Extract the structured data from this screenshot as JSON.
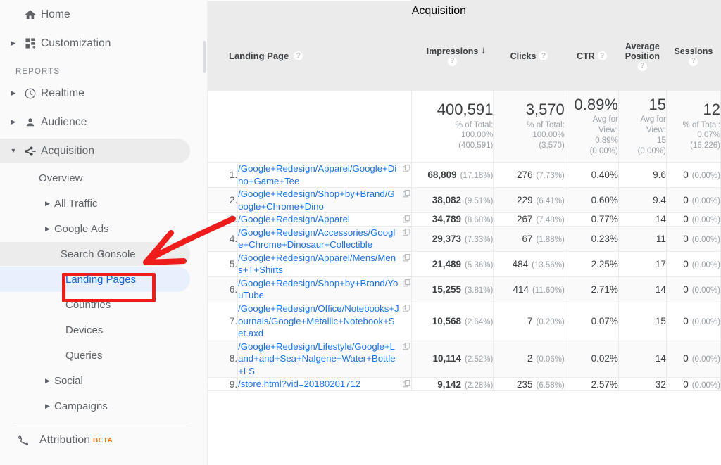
{
  "sidebar": {
    "top_items": [
      {
        "label": "Home",
        "icon": "home-icon",
        "has_arrow": false
      },
      {
        "label": "Customization",
        "icon": "customization-icon",
        "has_arrow": true
      }
    ],
    "section_label": "REPORTS",
    "report_items": [
      {
        "label": "Realtime",
        "icon": "clock-icon",
        "has_arrow": true,
        "state": "normal"
      },
      {
        "label": "Audience",
        "icon": "person-icon",
        "has_arrow": true,
        "state": "normal"
      },
      {
        "label": "Acquisition",
        "icon": "acquisition-icon",
        "has_arrow": true,
        "state": "expanded-highlight"
      }
    ],
    "acquisition_children": [
      {
        "label": "Overview",
        "has_caret": false,
        "state": "normal"
      },
      {
        "label": "All Traffic",
        "has_caret": true,
        "state": "normal"
      },
      {
        "label": "Google Ads",
        "has_caret": true,
        "state": "normal"
      },
      {
        "label": "Search Console",
        "has_caret": true,
        "state": "expanded-highlight"
      },
      {
        "label": "Landing Pages",
        "has_caret": false,
        "state": "selected",
        "annotated": true
      },
      {
        "label": "Countries",
        "has_caret": false,
        "state": "normal"
      },
      {
        "label": "Devices",
        "has_caret": false,
        "state": "normal"
      },
      {
        "label": "Queries",
        "has_caret": false,
        "state": "normal"
      },
      {
        "label": "Social",
        "has_caret": true,
        "state": "normal"
      },
      {
        "label": "Campaigns",
        "has_caret": true,
        "state": "normal"
      }
    ],
    "attribution": {
      "label": "Attribution",
      "badge": "BETA",
      "icon": "attribution-icon"
    },
    "colors": {
      "selected_bg": "#e8f0fe",
      "selected_text": "#1967d2",
      "highlight_bg": "#ececec",
      "text": "#5f6368",
      "beta_badge": "#e8710a"
    }
  },
  "table": {
    "group_header": "Acquisition",
    "dimension_header": {
      "label": "Landing Page",
      "help": "?"
    },
    "columns": [
      {
        "label": "Impressions",
        "help": "?",
        "sorted": true,
        "sort_dir": "desc",
        "sort_glyph": "↓"
      },
      {
        "label": "Clicks",
        "help": "?",
        "sorted": false
      },
      {
        "label": "CTR",
        "help": "?",
        "sorted": false
      },
      {
        "label": "Average Position",
        "help": "?",
        "sorted": false
      },
      {
        "label": "Sessions",
        "help": "?",
        "sorted": false
      }
    ],
    "summary": [
      {
        "big": "400,591",
        "lines": [
          "% of Total:",
          "100.00%",
          "(400,591)"
        ]
      },
      {
        "big": "3,570",
        "lines": [
          "% of Total:",
          "100.00%",
          "(3,570)"
        ]
      },
      {
        "big": "0.89%",
        "lines": [
          "Avg for",
          "View:",
          "0.89%",
          "(0.00%)"
        ]
      },
      {
        "big": "15",
        "lines": [
          "Avg for",
          "View:",
          "15",
          "(0.00%)"
        ]
      },
      {
        "big": "12",
        "lines": [
          "% of Total:",
          "0.07%",
          "(16,226)"
        ]
      }
    ],
    "rows": [
      {
        "index": "1.",
        "url": "/Google+Redesign/Apparel/Google+Dino+Game+Tee",
        "impressions": "68,809",
        "impressions_pct": "(17.18%)",
        "clicks": "276",
        "clicks_pct": "(7.73%)",
        "ctr": "0.40%",
        "avg_position": "9.6",
        "sessions": "0",
        "sessions_pct": "(0.00%)"
      },
      {
        "index": "2.",
        "url": "/Google+Redesign/Shop+by+Brand/Google+Chrome+Dino",
        "impressions": "38,082",
        "impressions_pct": "(9.51%)",
        "clicks": "229",
        "clicks_pct": "(6.41%)",
        "ctr": "0.60%",
        "avg_position": "9.4",
        "sessions": "0",
        "sessions_pct": "(0.00%)"
      },
      {
        "index": "3.",
        "url": "/Google+Redesign/Apparel",
        "impressions": "34,789",
        "impressions_pct": "(8.68%)",
        "clicks": "267",
        "clicks_pct": "(7.48%)",
        "ctr": "0.77%",
        "avg_position": "14",
        "sessions": "0",
        "sessions_pct": "(0.00%)"
      },
      {
        "index": "4.",
        "url": "/Google+Redesign/Accessories/Google+Chrome+Dinosaur+Collectible",
        "impressions": "29,373",
        "impressions_pct": "(7.33%)",
        "clicks": "67",
        "clicks_pct": "(1.88%)",
        "ctr": "0.23%",
        "avg_position": "11",
        "sessions": "0",
        "sessions_pct": "(0.00%)"
      },
      {
        "index": "5.",
        "url": "/Google+Redesign/Apparel/Mens/Mens+T+Shirts",
        "impressions": "21,489",
        "impressions_pct": "(5.36%)",
        "clicks": "484",
        "clicks_pct": "(13.56%)",
        "ctr": "2.25%",
        "avg_position": "17",
        "sessions": "0",
        "sessions_pct": "(0.00%)"
      },
      {
        "index": "6.",
        "url": "/Google+Redesign/Shop+by+Brand/YouTube",
        "impressions": "15,255",
        "impressions_pct": "(3.81%)",
        "clicks": "414",
        "clicks_pct": "(11.60%)",
        "ctr": "2.71%",
        "avg_position": "14",
        "sessions": "0",
        "sessions_pct": "(0.00%)"
      },
      {
        "index": "7.",
        "url": "/Google+Redesign/Office/Notebooks+Journals/Google+Metallic+Notebook+Set.axd",
        "impressions": "10,568",
        "impressions_pct": "(2.64%)",
        "clicks": "7",
        "clicks_pct": "(0.20%)",
        "ctr": "0.07%",
        "avg_position": "15",
        "sessions": "0",
        "sessions_pct": "(0.00%)"
      },
      {
        "index": "8.",
        "url": "/Google+Redesign/Lifestyle/Google+Land+and+Sea+Nalgene+Water+Bottle+LS",
        "impressions": "10,114",
        "impressions_pct": "(2.52%)",
        "clicks": "2",
        "clicks_pct": "(0.06%)",
        "ctr": "0.02%",
        "avg_position": "14",
        "sessions": "0",
        "sessions_pct": "(0.00%)"
      },
      {
        "index": "9.",
        "url": "/store.html?vid=20180201712",
        "impressions": "9,142",
        "impressions_pct": "(2.28%)",
        "clicks": "235",
        "clicks_pct": "(6.58%)",
        "ctr": "2.57%",
        "avg_position": "32",
        "sessions": "0",
        "sessions_pct": "(0.00%)"
      }
    ]
  },
  "annotations": {
    "arrow_color": "#ef1c1c",
    "box_color": "#ef1c1c",
    "target": "Landing Pages"
  }
}
